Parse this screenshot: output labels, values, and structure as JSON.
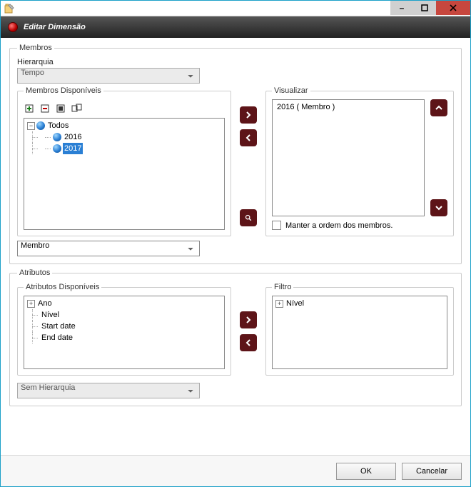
{
  "titlebar": {
    "minimize": "–",
    "maximize": "□",
    "close": "✕"
  },
  "header": {
    "title": "Editar Dimensão"
  },
  "membros": {
    "legend": "Membros",
    "hierarquia_label": "Hierarquia",
    "hierarquia_value": "Tempo",
    "disponiveis": {
      "legend": "Membros Disponíveis",
      "tree": {
        "root": {
          "label": "Todos",
          "expanded": true
        },
        "children": [
          {
            "label": "2016",
            "selected": false
          },
          {
            "label": "2017",
            "selected": true
          }
        ]
      },
      "combo_value": "Membro"
    },
    "visualizar": {
      "legend": "Visualizar",
      "items": [
        "2016 ( Membro )"
      ],
      "manter_label": "Manter a ordem dos membros."
    }
  },
  "atributos": {
    "legend": "Atributos",
    "disponiveis": {
      "legend": "Atributos Disponíveis",
      "items": [
        {
          "label": "Ano",
          "expander": "+"
        },
        {
          "label": "Nível"
        },
        {
          "label": "Start date"
        },
        {
          "label": "End date"
        }
      ]
    },
    "filtro": {
      "legend": "Filtro",
      "items": [
        {
          "label": "Nível",
          "expander": "+"
        }
      ]
    },
    "bottom_combo_value": "Sem Hierarquia"
  },
  "footer": {
    "ok": "OK",
    "cancel": "Cancelar"
  },
  "icons": {
    "right": ">",
    "left": "<",
    "search": "⌕",
    "up": "˄",
    "down": "˅"
  }
}
